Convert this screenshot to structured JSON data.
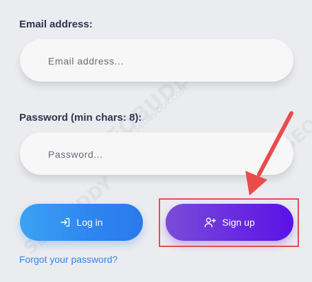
{
  "form": {
    "email_label": "Email address:",
    "email_placeholder": "Email address...",
    "password_label": "Password (min chars: 8):",
    "password_placeholder": "Password...",
    "login_label": "Log in",
    "signup_label": "Sign up",
    "forgot_link": "Forgot your password?"
  },
  "watermark": {
    "text": "SEOBUDDY",
    "url": "WWW.SEOBUDDY.COM"
  },
  "icons": {
    "login": "login-icon",
    "signup": "user-plus-icon"
  },
  "colors": {
    "background": "#ebecef",
    "login_button": "#2f86f0",
    "signup_button": "#6a2ee0",
    "annotation": "#ea4b4b",
    "link": "#2f86f0"
  }
}
